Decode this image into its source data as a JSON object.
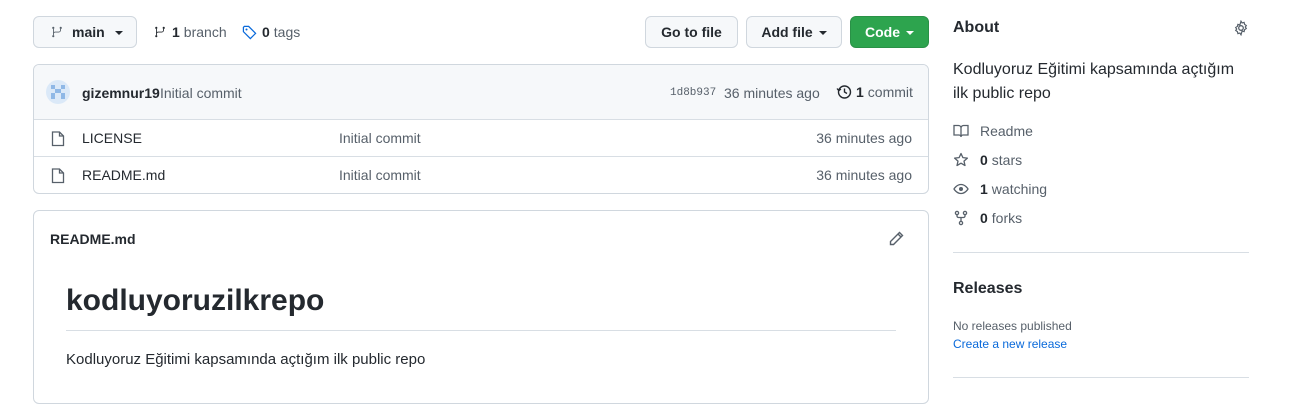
{
  "toolbar": {
    "branch_select": "main",
    "branch_count": "1",
    "branch_label": "branch",
    "tag_count": "0",
    "tag_label": "tags",
    "go_to_file": "Go to file",
    "add_file": "Add file",
    "code": "Code"
  },
  "commit_bar": {
    "author": "gizemnur19",
    "message": "Initial commit",
    "hash": "1d8b937",
    "time": "36 minutes ago",
    "commit_count": "1",
    "commit_label": "commit"
  },
  "files": [
    {
      "name": "LICENSE",
      "message": "Initial commit",
      "time": "36 minutes ago",
      "icon": "file-icon"
    },
    {
      "name": "README.md",
      "message": "Initial commit",
      "time": "36 minutes ago",
      "icon": "file-icon"
    }
  ],
  "readme": {
    "filename": "README.md",
    "heading": "kodluyoruzilkrepo",
    "body": "Kodluyoruz Eğitimi kapsamında açtığım ilk public repo"
  },
  "about": {
    "title": "About",
    "description": "Kodluyoruz Eğitimi kapsamında açtığım ilk public repo",
    "readme_label": "Readme",
    "stars_count": "0",
    "stars_label": "stars",
    "watching_count": "1",
    "watching_label": "watching",
    "forks_count": "0",
    "forks_label": "forks"
  },
  "releases": {
    "title": "Releases",
    "none": "No releases published",
    "create_link": "Create a new release"
  },
  "colors": {
    "accent_link": "#0969da",
    "primary_button": "#2da44e",
    "border": "#d0d7de",
    "muted_text": "#57606a"
  }
}
